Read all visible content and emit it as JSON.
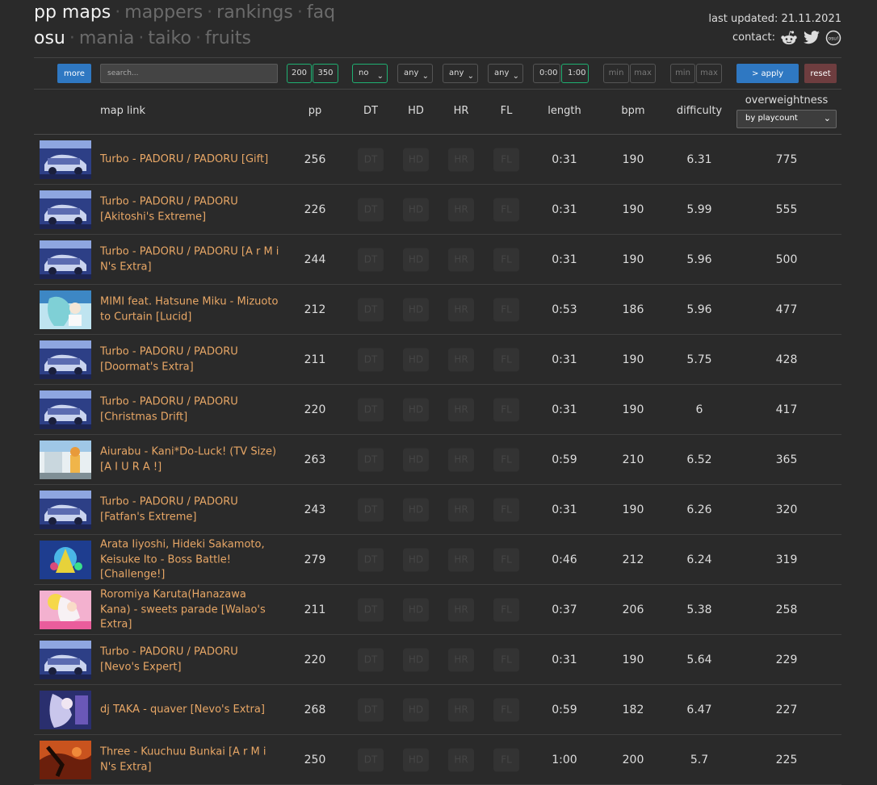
{
  "nav": {
    "row1": {
      "current": "pp maps",
      "links": [
        "mappers",
        "rankings",
        "faq"
      ]
    },
    "row2": {
      "current": "osu",
      "links": [
        "mania",
        "taiko",
        "fruits"
      ]
    },
    "separator": "·"
  },
  "info": {
    "last_updated": "last updated: 21.11.2021",
    "contact_label": "contact:",
    "contact_icons": [
      "reddit-icon",
      "twitter-icon",
      "osu-icon"
    ],
    "osu_badge": "osu!"
  },
  "filters": {
    "more_label": "more",
    "search_placeholder": "search...",
    "pp_min": "200",
    "pp_max": "350",
    "dt_select": "no",
    "hd_select": "any",
    "hr_select": "any",
    "fl_select": "any",
    "length_min": "0:00",
    "length_max": "1:00",
    "bpm_min_placeholder": "min",
    "bpm_max_placeholder": "max",
    "diff_min_placeholder": "min",
    "diff_max_placeholder": "max",
    "apply_label": "> apply",
    "reset_label": "reset"
  },
  "table": {
    "headers": {
      "map_link": "map link",
      "pp": "pp",
      "dt": "DT",
      "hd": "HD",
      "hr": "HR",
      "fl": "FL",
      "length": "length",
      "bpm": "bpm",
      "difficulty": "difficulty",
      "overweightness": "overweightness"
    },
    "sort_select": "by playcount",
    "mod_labels": [
      "DT",
      "HD",
      "HR",
      "FL"
    ],
    "rows": [
      {
        "title": "Turbo - PADORU / PADORU [Gift]",
        "pp": "256",
        "length": "0:31",
        "bpm": "190",
        "difficulty": "6.31",
        "overweightness": "775",
        "thumb": "padoru"
      },
      {
        "title": "Turbo - PADORU / PADORU [Akitoshi's Extreme]",
        "pp": "226",
        "length": "0:31",
        "bpm": "190",
        "difficulty": "5.99",
        "overweightness": "555",
        "thumb": "padoru"
      },
      {
        "title": "Turbo - PADORU / PADORU [A r M i N's Extra]",
        "pp": "244",
        "length": "0:31",
        "bpm": "190",
        "difficulty": "5.96",
        "overweightness": "500",
        "thumb": "padoru"
      },
      {
        "title": "MIMI feat. Hatsune Miku - Mizuoto to Curtain [Lucid]",
        "pp": "212",
        "length": "0:53",
        "bpm": "186",
        "difficulty": "5.96",
        "overweightness": "477",
        "thumb": "mimi"
      },
      {
        "title": "Turbo - PADORU / PADORU [Doormat's Extra]",
        "pp": "211",
        "length": "0:31",
        "bpm": "190",
        "difficulty": "5.75",
        "overweightness": "428",
        "thumb": "padoru"
      },
      {
        "title": "Turbo - PADORU / PADORU [Christmas Drift]",
        "pp": "220",
        "length": "0:31",
        "bpm": "190",
        "difficulty": "6",
        "overweightness": "417",
        "thumb": "padoru"
      },
      {
        "title": "Aiurabu - Kani*Do-Luck! (TV Size) [A I U R A !]",
        "pp": "263",
        "length": "0:59",
        "bpm": "210",
        "difficulty": "6.52",
        "overweightness": "365",
        "thumb": "aiura"
      },
      {
        "title": "Turbo - PADORU / PADORU [Fatfan's Extreme]",
        "pp": "243",
        "length": "0:31",
        "bpm": "190",
        "difficulty": "6.26",
        "overweightness": "320",
        "thumb": "padoru"
      },
      {
        "title": "Arata Iiyoshi, Hideki Sakamoto, Keisuke Ito - Boss Battle! [Challenge!]",
        "pp": "279",
        "length": "0:46",
        "bpm": "212",
        "difficulty": "6.24",
        "overweightness": "319",
        "thumb": "boss"
      },
      {
        "title": "Roromiya Karuta(Hanazawa Kana) - sweets parade [Walao's Extra]",
        "pp": "211",
        "length": "0:37",
        "bpm": "206",
        "difficulty": "5.38",
        "overweightness": "258",
        "thumb": "sweets"
      },
      {
        "title": "Turbo - PADORU / PADORU [Nevo's Expert]",
        "pp": "220",
        "length": "0:31",
        "bpm": "190",
        "difficulty": "5.64",
        "overweightness": "229",
        "thumb": "padoru"
      },
      {
        "title": "dj TAKA - quaver [Nevo's Extra]",
        "pp": "268",
        "length": "0:59",
        "bpm": "182",
        "difficulty": "6.47",
        "overweightness": "227",
        "thumb": "quaver"
      },
      {
        "title": "Three - Kuuchuu Bunkai [A r M i N's Extra]",
        "pp": "250",
        "length": "1:00",
        "bpm": "200",
        "difficulty": "5.7",
        "overweightness": "225",
        "thumb": "three"
      }
    ]
  },
  "colors": {
    "background": "#2a2a2a",
    "link": "#e8a766",
    "accent_blue": "#2f78c2",
    "reset_red": "#6e3d3f",
    "active_green": "#1fb072"
  }
}
